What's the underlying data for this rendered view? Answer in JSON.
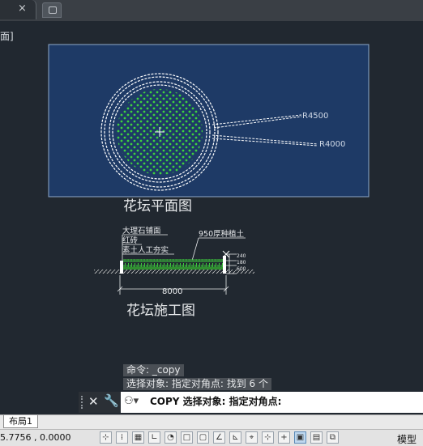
{
  "tab": {
    "close": "×"
  },
  "viewport": {
    "label": "面]"
  },
  "plan": {
    "title": "花坛平面图",
    "radius_labels": [
      "R4500",
      "R4000"
    ]
  },
  "section": {
    "title": "花坛施工图",
    "labels": [
      "大理石铺面",
      "红砖",
      "素土人工夯实",
      "950厚种植土"
    ],
    "heights": [
      "240",
      "180",
      "600"
    ],
    "width_dim": "8000"
  },
  "command": {
    "history": [
      "命令: _copy",
      "选择对象: 指定对角点: 找到 6 个"
    ],
    "current": "COPY 选择对象: 指定对角点:"
  },
  "layout_tab": "布局1",
  "status": {
    "coordinates": "5.7756 , 0.0000",
    "model": "模型",
    "icons": [
      "ucs-icon",
      "snap-icon",
      "grid-icon",
      "ortho-icon",
      "polar-icon",
      "osnap-icon",
      "3dosnap-icon",
      "otrack-icon",
      "ducs-icon",
      "dyn-icon",
      "lineweight-icon",
      "transparency-icon",
      "quickprops-icon",
      "selcycle-icon",
      "annotation-monitor-icon"
    ]
  },
  "colors": {
    "background": "#212830",
    "selection_window": "#1e3a66",
    "hatch_green": "#3ed23e"
  }
}
